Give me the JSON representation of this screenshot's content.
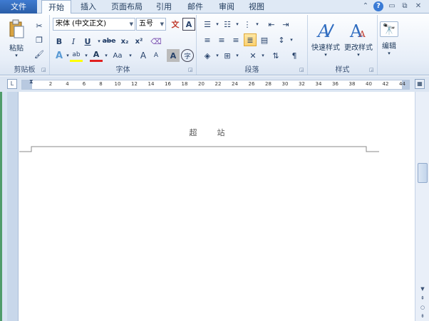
{
  "tabs": {
    "file": "文件",
    "items": [
      "开始",
      "插入",
      "页面布局",
      "引用",
      "邮件",
      "审阅",
      "视图"
    ],
    "active_index": 0
  },
  "window_controls": {
    "collapse": "⌃",
    "help": "?",
    "minimize": "▭",
    "restore": "⧉",
    "close": "✕"
  },
  "clipboard": {
    "paste_label": "粘贴",
    "group_label": "剪贴板"
  },
  "font": {
    "font_name": "宋体 (中文正文)",
    "font_size": "五号",
    "group_label": "字体",
    "wen_glyph": "A",
    "pinyin_glyph": "文",
    "bold": "B",
    "italic": "I",
    "underline": "U",
    "strike": "abe",
    "subscript": "x₂",
    "superscript": "x²",
    "highlight": "ab",
    "font_color": "A",
    "change_case": "Aa",
    "grow": "A",
    "shrink": "A",
    "char_shade": "A",
    "enclose": "字"
  },
  "paragraph": {
    "group_label": "段落"
  },
  "styles": {
    "quick_styles_label": "快速样式",
    "change_styles_label": "更改样式",
    "group_label": "样式"
  },
  "editing": {
    "label": "编辑"
  },
  "ruler": {
    "corner": "L",
    "ticks": [
      "2",
      "4",
      "6",
      "8",
      "10",
      "12",
      "14",
      "16",
      "18",
      "20",
      "22",
      "24",
      "26",
      "28",
      "30",
      "32",
      "34",
      "36",
      "38",
      "40",
      "42",
      "44"
    ]
  },
  "document": {
    "header_text": "超站"
  },
  "colors": {
    "accent": "#2a5ea8",
    "ribbon_bg": "#e7eef8",
    "highlight_active": "#fbd170"
  }
}
